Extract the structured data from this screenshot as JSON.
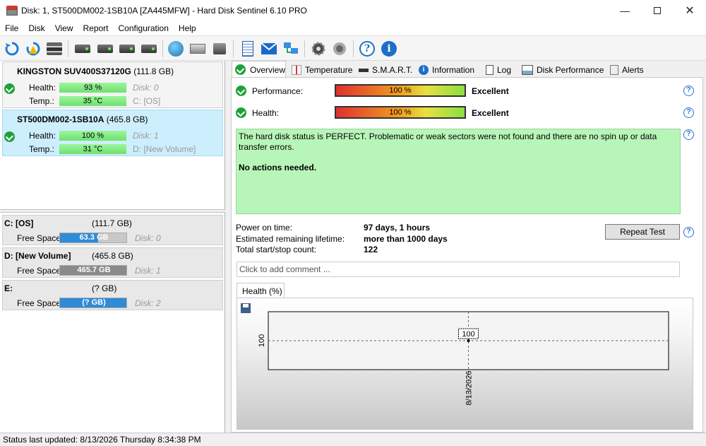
{
  "window": {
    "title": "Disk: 1, ST500DM002-1SB10A [ZA445MFW]  -  Hard Disk Sentinel 6.10 PRO",
    "controls": [
      "minimize",
      "maximize",
      "close"
    ]
  },
  "menu": [
    "File",
    "Disk",
    "View",
    "Report",
    "Configuration",
    "Help"
  ],
  "toolbar": {
    "icons": [
      "refresh-icon",
      "refresh-warning-icon",
      "disk-list-icon",
      "disk-info-icon",
      "disk-schedule-icon",
      "disk-check-icon",
      "disk-search-icon",
      "globe-disk-icon",
      "disk-stack-icon",
      "disk-usb-icon",
      "notepad-icon",
      "email-icon",
      "network-icon",
      "settings-icon",
      "sound-icon",
      "help-icon",
      "info-icon"
    ]
  },
  "disks": [
    {
      "name": "KINGSTON SUV400S37120G",
      "size": "(111.8 GB)",
      "health_label": "Health:",
      "health": "93 %",
      "temp_label": "Temp.:",
      "temp": "35 °C",
      "disk_ref": "Disk: 0",
      "drive": "C: [OS]",
      "selected": false
    },
    {
      "name": "ST500DM002-1SB10A",
      "size": "(465.8 GB)",
      "health_label": "Health:",
      "health": "100 %",
      "temp_label": "Temp.:",
      "temp": "31 °C",
      "disk_ref": "Disk: 1",
      "drive": "D: [New Volume]",
      "selected": true
    }
  ],
  "volumes": [
    {
      "name": "C: [OS]",
      "size": "(111.7 GB)",
      "free_label": "Free Space",
      "free": "63.3 GB",
      "disk": "Disk: 0",
      "color": "#2f8bd6",
      "fill_fraction": 0.57
    },
    {
      "name": "D: [New Volume]",
      "size": "(465.8 GB)",
      "free_label": "Free Space",
      "free": "465.7 GB",
      "disk": "Disk: 1",
      "color": "#8a8a8a",
      "fill_fraction": 1.0
    },
    {
      "name": "E:",
      "size": "(? GB)",
      "free_label": "Free Space",
      "free": "(? GB)",
      "disk": "Disk: 2",
      "color": "#2f8bd6",
      "fill_fraction": 1.0
    }
  ],
  "tabs": [
    "Overview",
    "Temperature",
    "S.M.A.R.T.",
    "Information",
    "Log",
    "Disk Performance",
    "Alerts"
  ],
  "overview": {
    "performance_label": "Performance:",
    "performance_value": "100 %",
    "performance_rating": "Excellent",
    "health_label": "Health:",
    "health_value": "100 %",
    "health_rating": "Excellent",
    "status_line1": "The hard disk status is PERFECT. Problematic or weak sectors were not found and there are no spin up or data transfer errors.",
    "status_line2": "No actions needed.",
    "power_on_label": "Power on time:",
    "power_on_value": "97 days, 1 hours",
    "lifetime_label": "Estimated remaining lifetime:",
    "lifetime_value": "more than 1000 days",
    "startstop_label": "Total start/stop count:",
    "startstop_value": "122",
    "repeat_test": "Repeat Test",
    "comment_placeholder": "Click to add comment ...",
    "chart_tab": "Health (%)"
  },
  "chart_data": {
    "type": "line",
    "x": [
      "8/13/2026"
    ],
    "series": [
      {
        "values": [
          100
        ]
      }
    ],
    "y_tick": "100",
    "data_label": "100"
  },
  "statusbar": "Status last updated: 8/13/2026 Thursday 8:34:38 PM"
}
